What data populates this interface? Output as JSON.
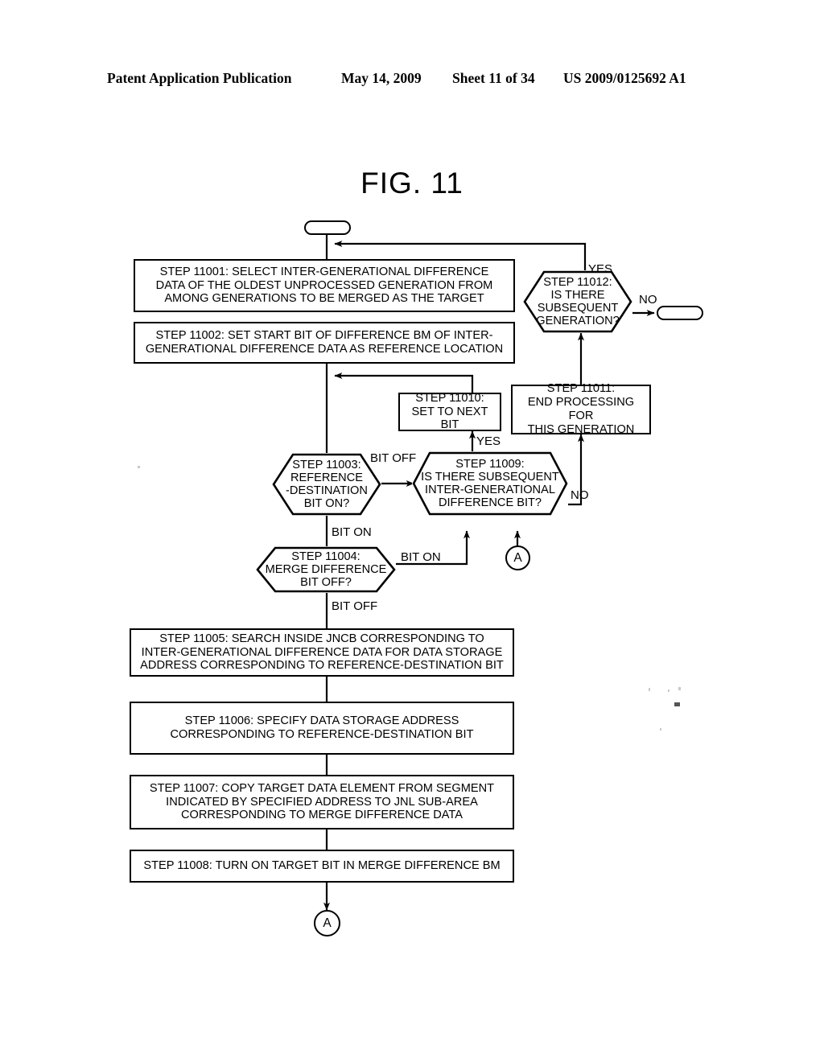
{
  "header": {
    "publication": "Patent Application Publication",
    "date": "May 14, 2009",
    "sheet": "Sheet 11 of 34",
    "docnumber": "US 2009/0125692 A1"
  },
  "figure": {
    "title": "FIG. 11"
  },
  "flowchart": {
    "type": "flowchart",
    "nodes": {
      "start_terminator": {
        "shape": "terminator",
        "label": ""
      },
      "end_terminator": {
        "shape": "terminator",
        "label": ""
      },
      "step_11001": {
        "shape": "process",
        "text": "STEP 11001: SELECT INTER-GENERATIONAL DIFFERENCE DATA OF THE OLDEST UNPROCESSED GENERATION FROM AMONG GENERATIONS TO BE MERGED AS THE TARGET"
      },
      "step_11002": {
        "shape": "process",
        "text": "STEP 11002: SET START BIT OF DIFFERENCE BM OF INTER-GENERATIONAL DIFFERENCE DATA AS REFERENCE LOCATION"
      },
      "step_11003": {
        "shape": "decision",
        "text": "STEP 11003: REFERENCE -DESTINATION BIT ON?"
      },
      "step_11004": {
        "shape": "decision",
        "text": "STEP 11004: MERGE DIFFERENCE BIT OFF?"
      },
      "step_11005": {
        "shape": "process",
        "text": "STEP 11005: SEARCH INSIDE JNCB CORRESPONDING TO INTER-GENERATIONAL DIFFERENCE DATA FOR DATA STORAGE ADDRESS CORRESPONDING TO REFERENCE-DESTINATION BIT"
      },
      "step_11006": {
        "shape": "process",
        "text": "STEP 11006: SPECIFY DATA STORAGE ADDRESS CORRESPONDING TO REFERENCE-DESTINATION BIT"
      },
      "step_11007": {
        "shape": "process",
        "text": "STEP 11007: COPY TARGET DATA ELEMENT FROM SEGMENT INDICATED BY SPECIFIED ADDRESS TO JNL SUB-AREA CORRESPONDING TO MERGE DIFFERENCE DATA"
      },
      "step_11008": {
        "shape": "process",
        "text": "STEP 11008: TURN ON TARGET BIT IN MERGE DIFFERENCE BM"
      },
      "step_11009": {
        "shape": "decision",
        "text": "STEP 11009: IS THERE SUBSEQUENT INTER-GENERATIONAL DIFFERENCE BIT?"
      },
      "step_11010": {
        "shape": "process",
        "text": "STEP 11010: SET TO NEXT BIT"
      },
      "step_11011": {
        "shape": "process",
        "text": "STEP 11011: END PROCESSING FOR THIS GENERATION"
      },
      "step_11012": {
        "shape": "decision",
        "text": "STEP 11012: IS THERE SUBSEQUENT GENERATION?"
      },
      "connector_a_top": {
        "shape": "connector",
        "label": "A"
      },
      "connector_a_bottom": {
        "shape": "connector",
        "label": "A"
      }
    },
    "edge_labels": {
      "step11012_yes": "YES",
      "step11012_no": "NO",
      "step11003_bit_off": "BIT OFF",
      "step11003_bit_on": "BIT ON",
      "step11004_bit_on": "BIT ON",
      "step11004_bit_off": "BIT OFF",
      "step11009_yes": "YES",
      "step11009_no": "NO"
    },
    "step_11001_lines": [
      "STEP 11001: SELECT INTER-GENERATIONAL DIFFERENCE",
      "DATA OF THE OLDEST UNPROCESSED GENERATION FROM",
      "AMONG GENERATIONS TO BE MERGED AS THE TARGET"
    ],
    "step_11002_lines": [
      "STEP 11002: SET START BIT OF DIFFERENCE BM OF INTER-",
      "GENERATIONAL DIFFERENCE DATA AS REFERENCE LOCATION"
    ],
    "step_11003_lines": [
      "STEP 11003:",
      "REFERENCE",
      "-DESTINATION",
      "BIT ON?"
    ],
    "step_11004_lines": [
      "STEP 11004:",
      "MERGE DIFFERENCE",
      "BIT OFF?"
    ],
    "step_11005_lines": [
      "STEP 11005: SEARCH INSIDE JNCB CORRESPONDING TO",
      "INTER-GENERATIONAL DIFFERENCE DATA FOR DATA STORAGE",
      "ADDRESS CORRESPONDING TO REFERENCE-DESTINATION BIT"
    ],
    "step_11006_lines": [
      "STEP 11006: SPECIFY DATA STORAGE ADDRESS",
      "CORRESPONDING TO REFERENCE-DESTINATION BIT"
    ],
    "step_11007_lines": [
      "STEP 11007: COPY TARGET DATA ELEMENT FROM SEGMENT",
      "INDICATED BY SPECIFIED ADDRESS TO JNL SUB-AREA",
      "CORRESPONDING TO MERGE DIFFERENCE DATA"
    ],
    "step_11008_lines": [
      "STEP 11008: TURN ON TARGET BIT IN MERGE DIFFERENCE BM"
    ],
    "step_11009_lines": [
      "STEP 11009:",
      "IS THERE SUBSEQUENT",
      "INTER-GENERATIONAL",
      "DIFFERENCE BIT?"
    ],
    "step_11010_lines": [
      "STEP 11010:",
      "SET TO NEXT BIT"
    ],
    "step_11011_lines": [
      "STEP 11011:",
      "END PROCESSING FOR",
      "THIS GENERATION"
    ],
    "step_11012_lines": [
      "STEP 11012:",
      "IS THERE",
      "SUBSEQUENT",
      "GENERATION?"
    ]
  },
  "colors": {
    "ink": "#000000",
    "paper": "#ffffff"
  }
}
